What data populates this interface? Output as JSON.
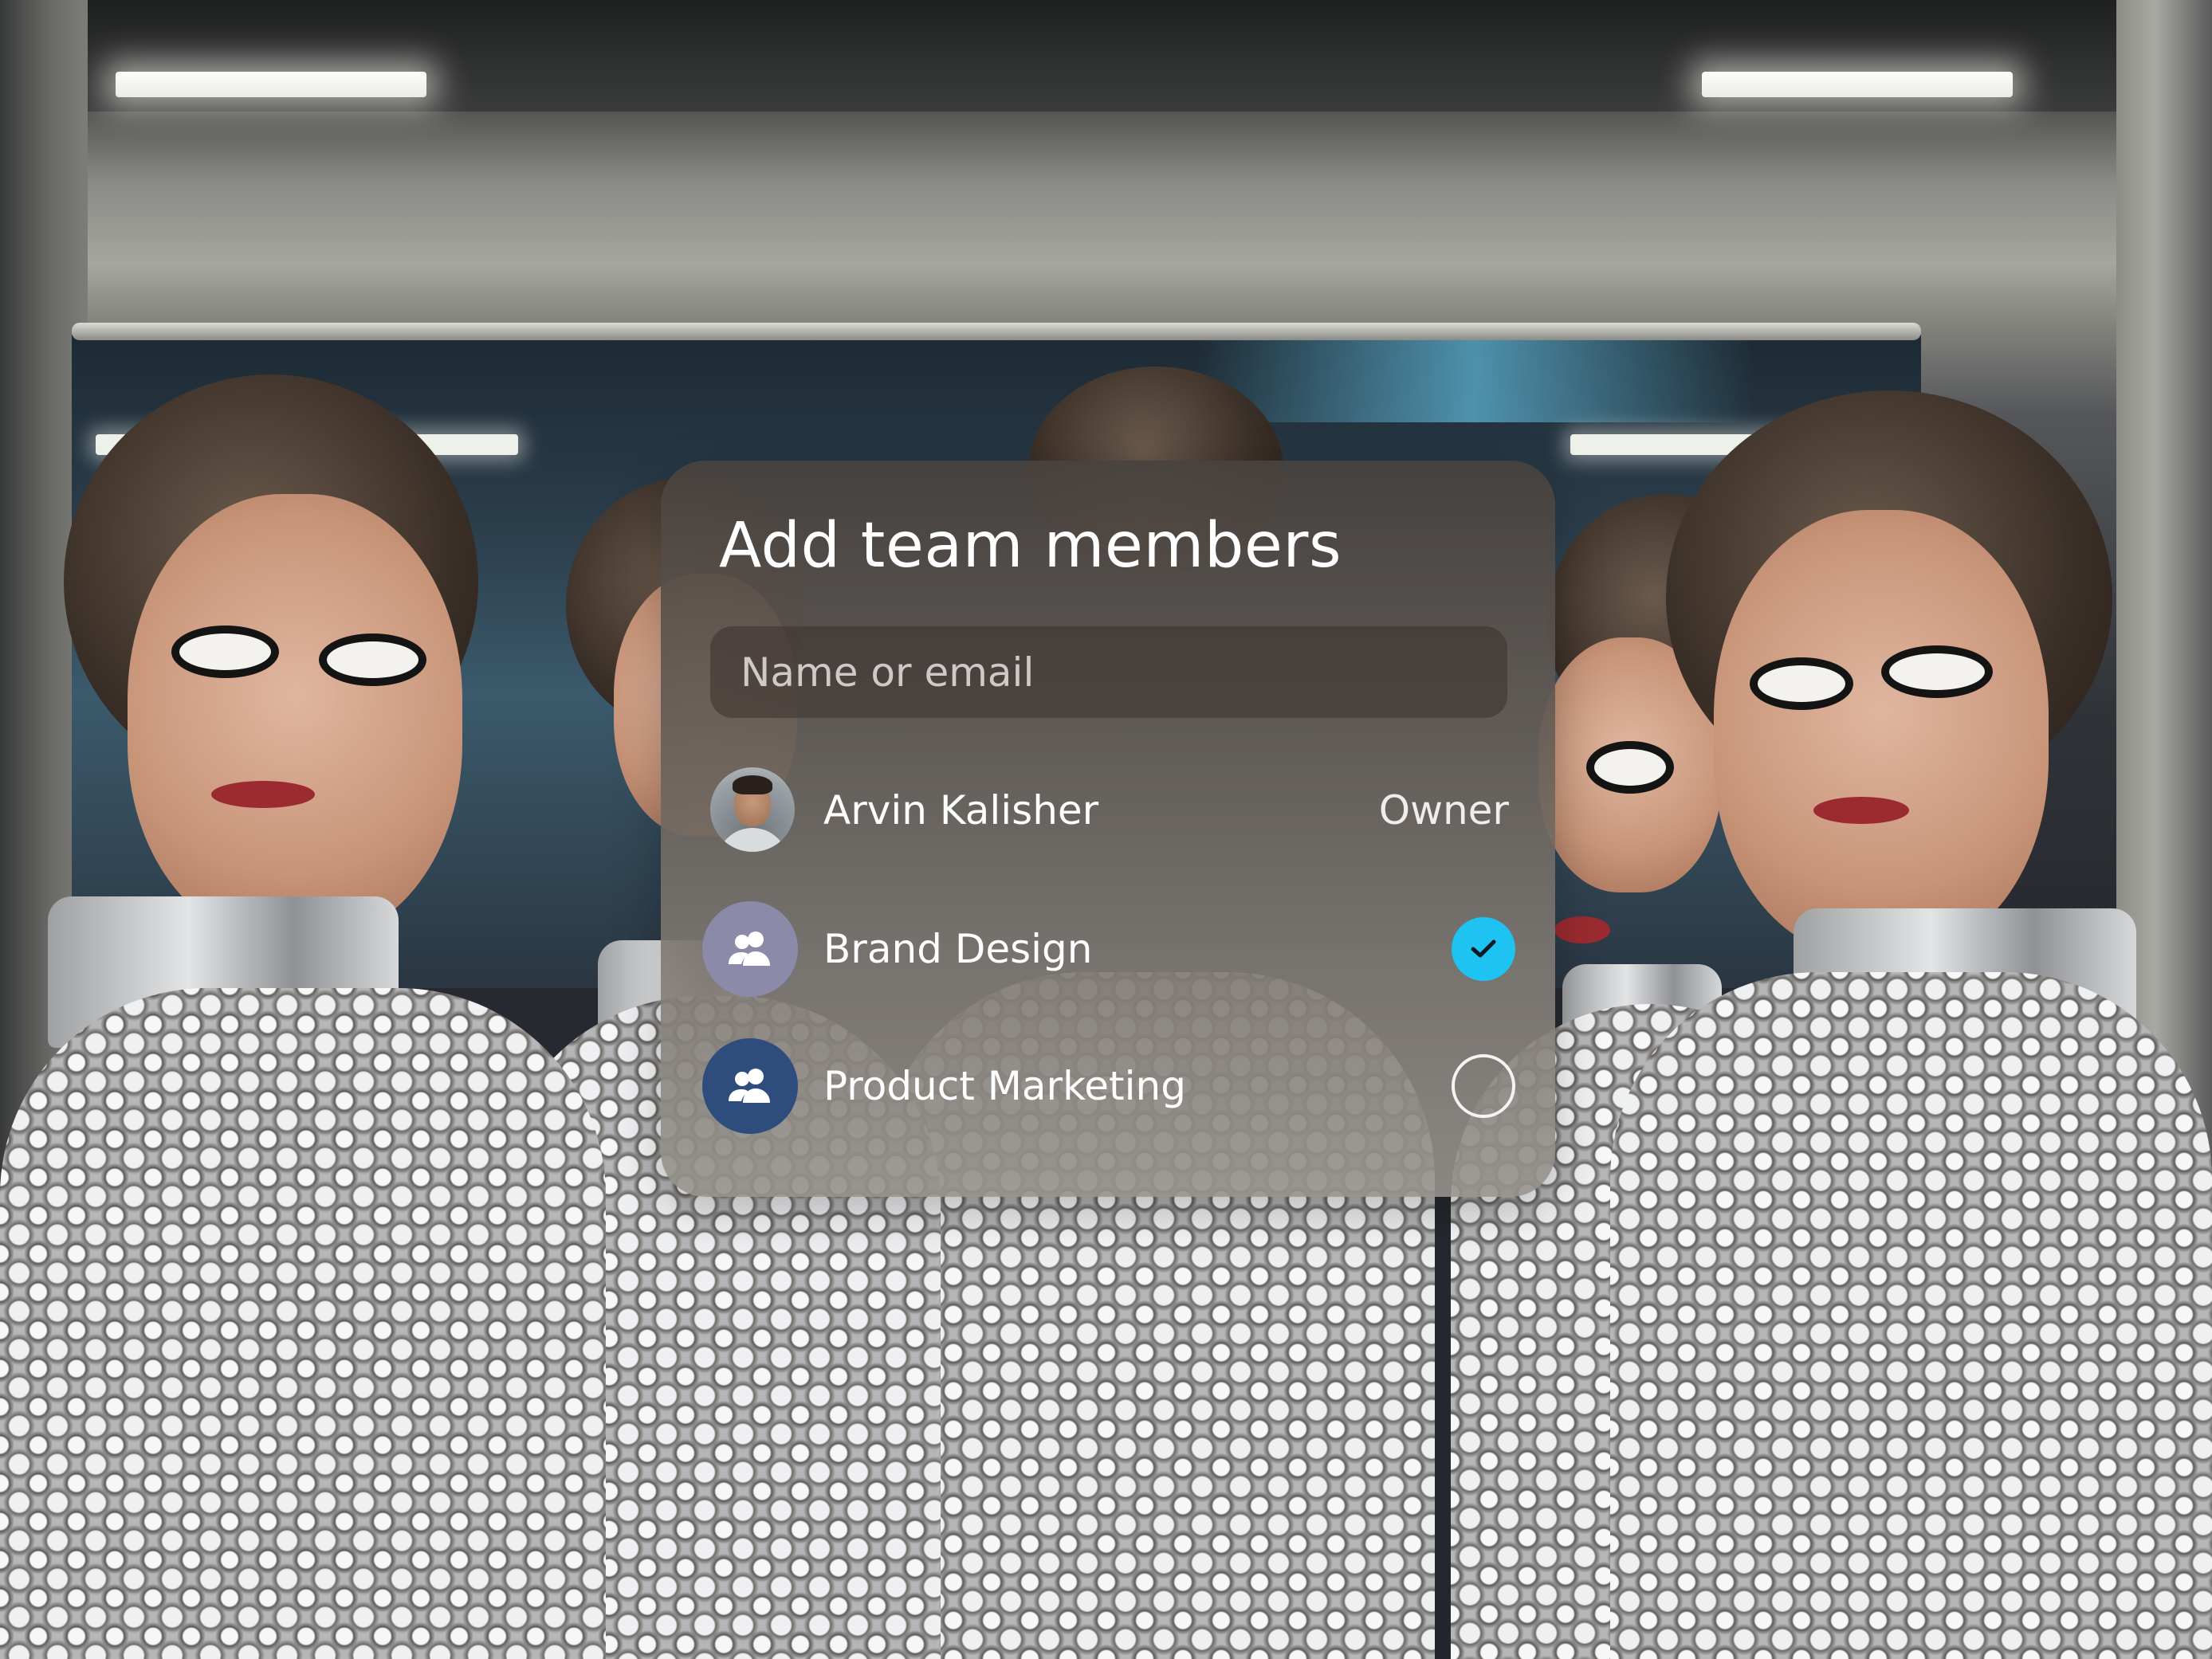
{
  "dialog": {
    "title": "Add team members",
    "search": {
      "placeholder": "Name or email",
      "value": ""
    },
    "members": [
      {
        "name": "Arvin Kalisher",
        "role": "Owner",
        "avatar": "person-photo"
      },
      {
        "name": "Brand Design",
        "avatar": "group-icon",
        "avatar_color": "#8b8aa8",
        "selected": true
      },
      {
        "name": "Product Marketing",
        "avatar": "group-icon",
        "avatar_color": "#2f4d7c",
        "selected": false
      }
    ]
  },
  "colors": {
    "accent": "#1ec3f2",
    "text": "#ffffff"
  }
}
